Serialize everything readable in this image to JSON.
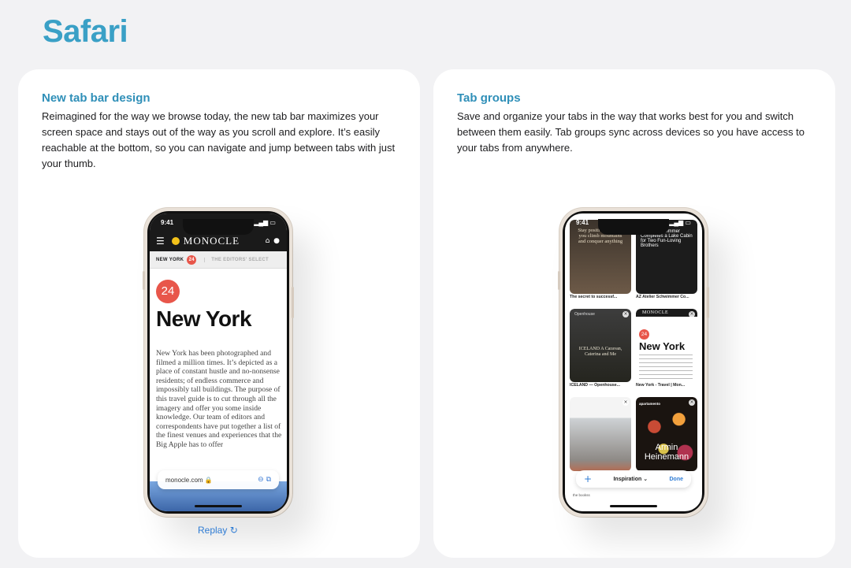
{
  "page_title": "Safari",
  "left_card": {
    "heading": "New tab bar design",
    "body": "Reimagined for the way we browse today, the new tab bar maximizes your screen space and stays out of the way as you scroll and explore. It’s easily reachable at the bottom, so you can navigate and jump between tabs with just your thumb.",
    "phone": {
      "time": "9:41",
      "site_logo": "MONOCLE",
      "city_tab": "NEW YORK",
      "city_badge": "24",
      "next_tab": "THE EDITORS' SELECT",
      "badge": "24",
      "headline": "New York",
      "article": "New York has been photographed and filmed a million times. It’s depicted as a place of constant hustle and no-nonsense residents; of endless commerce and impossibly tall buildings. The purpose of this travel guide is to cut through all the imagery and offer you some inside knowledge. Our team of editors and correspondents have put together a list of the finest venues and experiences that the Big Apple has to offer",
      "url": "monocle.com 🔒"
    },
    "replay_label": "Replay ↻"
  },
  "right_card": {
    "heading": "Tab groups",
    "body": "Save and organize your tabs in the way that works best for you and switch between them easily. Tab groups sync across devices so you have access to your tabs from anywhere.",
    "phone": {
      "time": "9:41",
      "tabs": [
        {
          "thumb_text": "Stay positive can help you climb mountains and conquer anything",
          "caption": "The secret to successf..."
        },
        {
          "thumb_text": "Atelier Schwimmer Completes a Lake Cabin for Two Fun-Loving Brothers",
          "caption": "AZ Atelier Schwimmer Co..."
        },
        {
          "header": "Openhouse",
          "thumb_text": "ICELAND A Caravan, Caterina and Me",
          "caption": "ICELAND — Openhouse..."
        },
        {
          "header": "MONOCLE",
          "badge": "24",
          "thumb_text": "New York",
          "caption": "New York - Travel | Mon..."
        },
        {
          "caption": ""
        },
        {
          "header": "apartamento",
          "thumb_text": "Armin Heinemann",
          "caption": ""
        }
      ],
      "group_name": "Inspiration ⌄",
      "add_label": "+",
      "done_label": "Done",
      "peek_tabs": [
        "the bookss",
        "",
        ""
      ]
    }
  }
}
